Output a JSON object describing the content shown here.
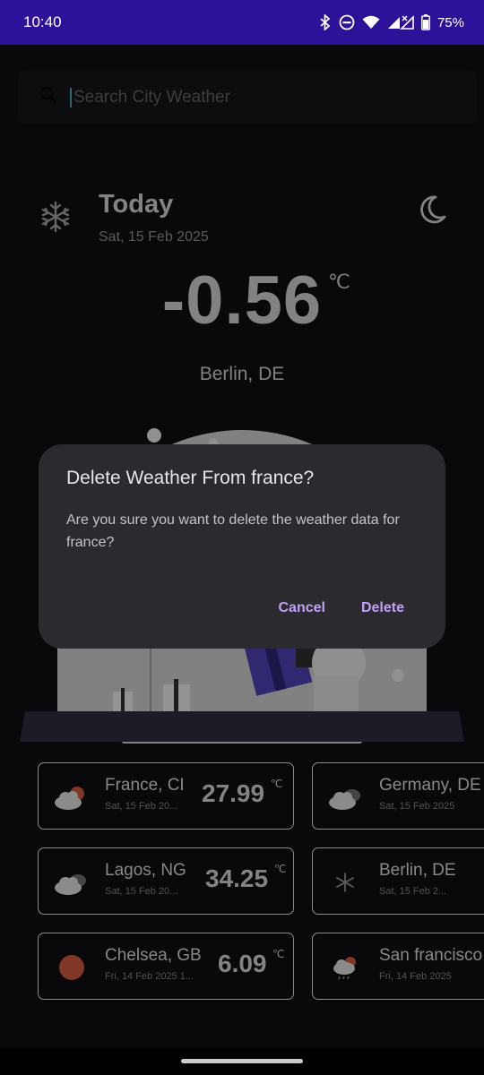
{
  "status_bar": {
    "time": "10:40",
    "battery": "75%"
  },
  "search": {
    "placeholder": "Search City Weather",
    "value": ""
  },
  "today": {
    "title": "Today",
    "date": "Sat, 15 Feb 2025",
    "temperature": "-0.56",
    "unit": "℃",
    "city": "Berlin, DE",
    "icon": "snowflake-icon",
    "theme_toggle_icon": "moon-icon"
  },
  "dialog": {
    "title": "Delete Weather From france?",
    "message": "Are you sure you want to delete the weather data for france?",
    "cancel_label": "Cancel",
    "delete_label": "Delete",
    "accent_color": "#c3a0f7"
  },
  "cards": [
    {
      "city": "France, CI",
      "date": "Sat, 15 Feb 20...",
      "temp": "27.99",
      "unit": "℃",
      "icon": "cloud-sun-icon"
    },
    {
      "city": "Germany, DE",
      "date": "Sat, 15 Feb 2025",
      "temp": "",
      "unit": "",
      "icon": "cloudy-icon"
    },
    {
      "city": "Lagos, NG",
      "date": "Sat, 15 Feb 20...",
      "temp": "34.25",
      "unit": "℃",
      "icon": "cloudy-icon"
    },
    {
      "city": "Berlin, DE",
      "date": "Sat, 15 Feb 2...",
      "temp": "",
      "unit": "",
      "icon": "snowflake-icon"
    },
    {
      "city": "Chelsea, GB",
      "date": "Fri, 14 Feb 2025 1...",
      "temp": "6.09",
      "unit": "℃",
      "icon": "sun-icon"
    },
    {
      "city": "San francisco",
      "date": "Fri, 14 Feb 2025",
      "temp": "",
      "unit": "",
      "icon": "cloud-rain-sun-icon"
    }
  ]
}
